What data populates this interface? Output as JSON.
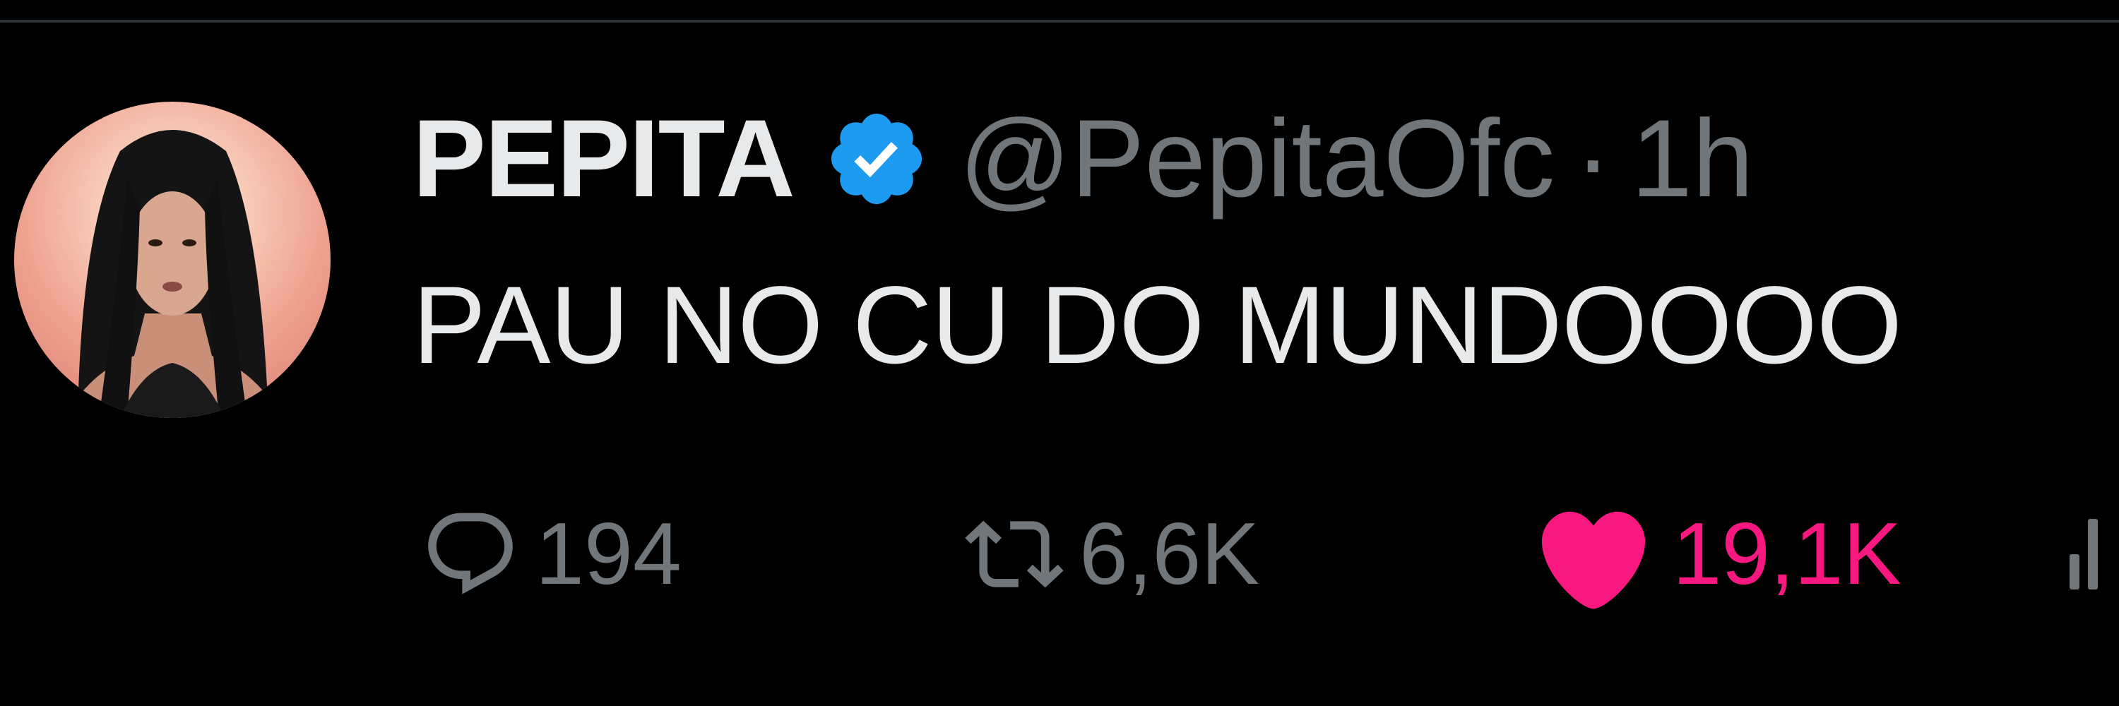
{
  "tweet": {
    "author": {
      "display_name": "PEPITA",
      "handle": "@PepitaOfc",
      "verified": true,
      "verified_color": "#1d9bf0"
    },
    "separator": "·",
    "time_ago": "1h",
    "text": "PAU NO CU DO MUNDOOOO",
    "actions": {
      "reply": {
        "icon": "reply-icon",
        "count": "194"
      },
      "retweet": {
        "icon": "retweet-icon",
        "count": "6,6K"
      },
      "like": {
        "icon": "heart-icon",
        "count": "19,1K",
        "active": true,
        "color": "#f91880"
      },
      "views": {
        "icon": "views-icon"
      }
    }
  },
  "colors": {
    "background": "#000000",
    "primary_text": "#e7e9ea",
    "secondary_text": "#71767b",
    "like_active": "#f91880",
    "verified_badge": "#1d9bf0"
  }
}
